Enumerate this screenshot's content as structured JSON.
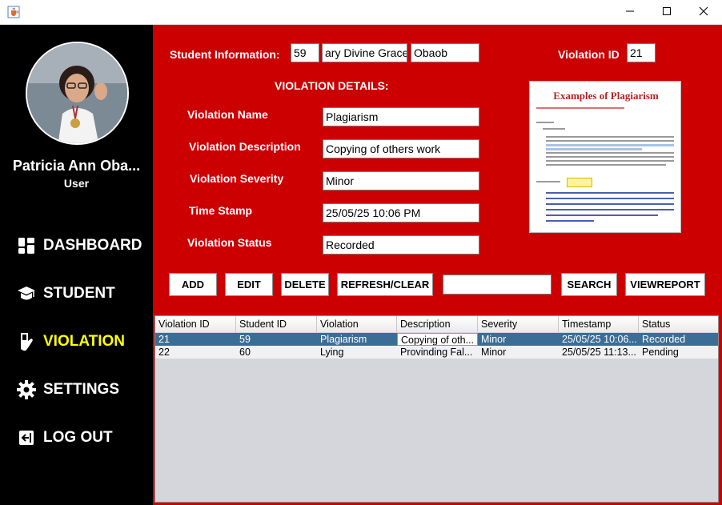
{
  "window": {
    "app_icon": "java-cup-icon",
    "controls": [
      "minimize-icon",
      "maximize-icon",
      "close-icon"
    ]
  },
  "sidebar": {
    "user_name": "Patricia Ann Oba...",
    "user_role": "User",
    "nav": [
      {
        "label": "DASHBOARD",
        "icon": "dashboard-icon"
      },
      {
        "label": "STUDENT",
        "icon": "graduation-cap-icon"
      },
      {
        "label": "VIOLATION",
        "icon": "hand-icon"
      },
      {
        "label": "SETTINGS",
        "icon": "gear-icon"
      },
      {
        "label": "LOG OUT",
        "icon": "logout-icon"
      }
    ],
    "active_color": "#ffff00"
  },
  "student_info": {
    "label": "Student Information:",
    "id": "59",
    "first_name": "ary Divine Grace",
    "last_name": "Obaob"
  },
  "violation_id": {
    "label": "Violation ID",
    "value": "21"
  },
  "details": {
    "heading": "VIOLATION DETAILS:",
    "fields": [
      {
        "label": "Violation Name",
        "value": "Plagiarism"
      },
      {
        "label": "Violation Description",
        "value": "Copying of others work"
      },
      {
        "label": "Violation Severity",
        "value": "Minor"
      },
      {
        "label": "Time Stamp",
        "value": "25/05/25 10:06 PM"
      },
      {
        "label": "Violation Status",
        "value": "Recorded"
      }
    ]
  },
  "preview": {
    "title": "Examples of Plagiarism"
  },
  "buttons": {
    "add": "ADD",
    "edit": "EDIT",
    "delete": "DELETE",
    "refresh": "REFRESH/CLEAR",
    "search": "SEARCH",
    "view_report": "VIEWREPORT"
  },
  "search": {
    "value": ""
  },
  "table": {
    "columns": [
      "Violation ID",
      "Student ID",
      "Violation",
      "Description",
      "Severity",
      "Timestamp",
      "Status"
    ],
    "rows": [
      [
        "21",
        "59",
        "Plagiarism",
        "Copying of oth...",
        "Minor",
        "25/05/25 10:06...",
        "Recorded"
      ],
      [
        "22",
        "60",
        "Lying",
        "Provinding Fal...",
        "Minor",
        "25/05/25 11:13...",
        "Pending"
      ]
    ]
  },
  "colors": {
    "sidebar_bg": "#000000",
    "main_bg": "#cc0000",
    "selected_row": "#3c6e95"
  }
}
